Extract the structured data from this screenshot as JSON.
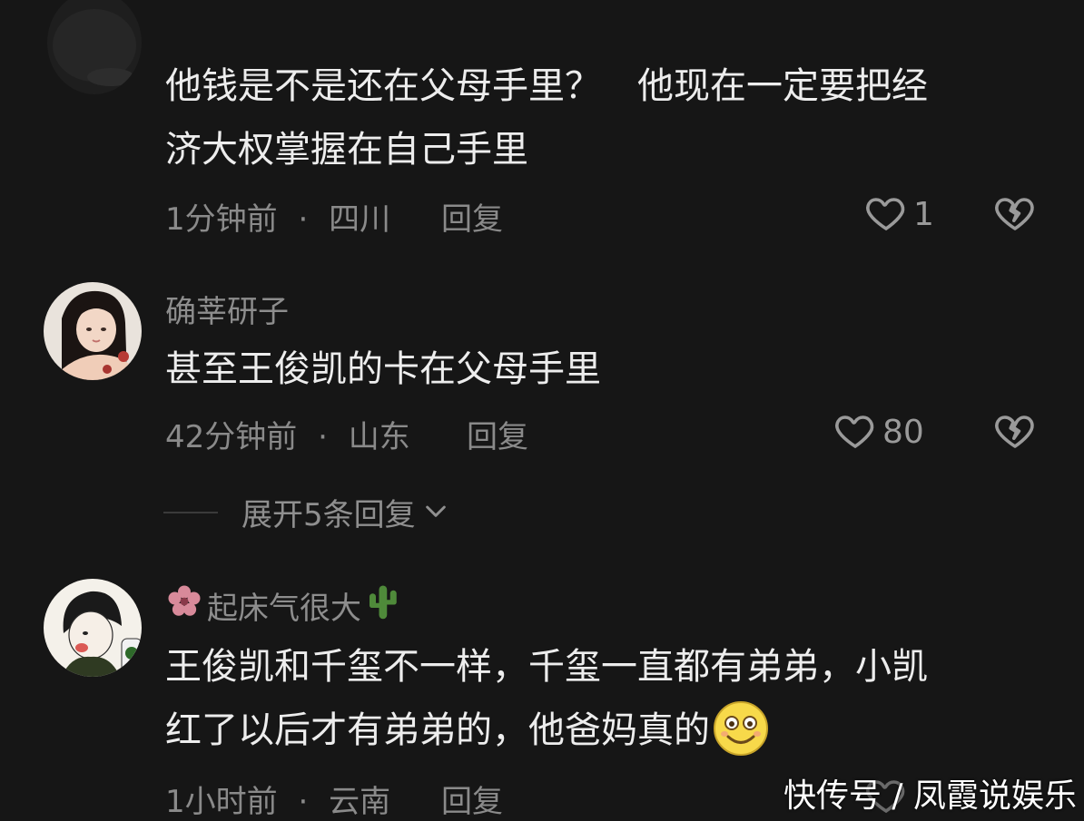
{
  "comments": [
    {
      "username": "",
      "text_lines": [
        "他钱是不是还在父母手里？　他现在一定要把经",
        "济大权掌握在自己手里"
      ],
      "time": "1分钟前",
      "separator": "·",
      "location": "四川",
      "reply_label": "回复",
      "like_count": "1"
    },
    {
      "username": "确莘研子",
      "text_lines": [
        "甚至王俊凯的卡在父母手里"
      ],
      "time": "42分钟前",
      "separator": "·",
      "location": "山东",
      "reply_label": "回复",
      "like_count": "80",
      "expand_label": "展开5条回复"
    },
    {
      "username": "起床气很大",
      "username_prefix_icon": "flower-icon",
      "username_suffix_icon": "cactus-icon",
      "text_lines": [
        "王俊凯和千玺不一样，千玺一直都有弟弟，小凯",
        "红了以后才有弟弟的，他爸妈真的"
      ],
      "trailing_emoji": "smile-emoji-icon",
      "time": "1小时前",
      "separator": "·",
      "location": "云南",
      "reply_label": "回复"
    }
  ],
  "watermark": "快传号 / 凤霞说娱乐",
  "colors": {
    "background": "#161616",
    "text": "#ededed",
    "meta": "#8a8a8a"
  }
}
